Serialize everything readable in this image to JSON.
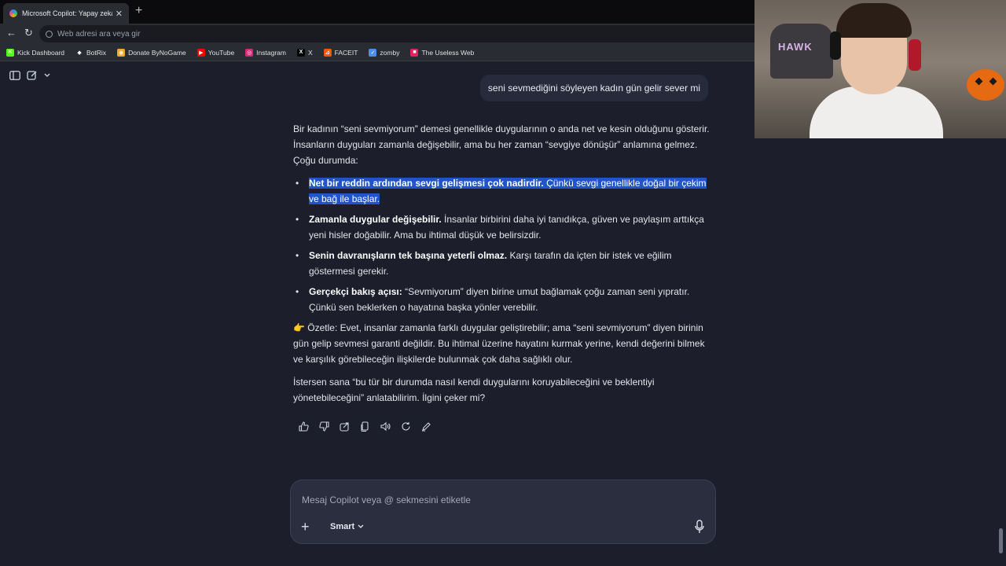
{
  "browser": {
    "tab_title": "Microsoft Copilot: Yapay zeka eşlik",
    "tab_close": "✕",
    "new_tab": "+",
    "address_placeholder": "Web adresi ara veya gir",
    "bookmarks": [
      {
        "label": "Kick Dashboard",
        "icon": "kick-icon",
        "color": "#53fc18",
        "glyph": "K"
      },
      {
        "label": "BotRix",
        "icon": "botrix-icon",
        "color": "#ffffff",
        "glyph": "◆"
      },
      {
        "label": "Donate ByNoGame",
        "icon": "bynogame-icon",
        "color": "#f5a623",
        "glyph": "◉"
      },
      {
        "label": "YouTube",
        "icon": "youtube-icon",
        "color": "#ff0000",
        "glyph": "▶"
      },
      {
        "label": "Instagram",
        "icon": "instagram-icon",
        "color": "#d62976",
        "glyph": "◎"
      },
      {
        "label": "X",
        "icon": "x-icon",
        "color": "#000000",
        "glyph": "X"
      },
      {
        "label": "FACEIT",
        "icon": "faceit-icon",
        "color": "#ff5500",
        "glyph": "⊿"
      },
      {
        "label": "zomby",
        "icon": "zomby-icon",
        "color": "#4a8ef0",
        "glyph": "✓"
      },
      {
        "label": "The Useless Web",
        "icon": "uselessweb-icon",
        "color": "#e0245e",
        "glyph": "■"
      }
    ]
  },
  "chat": {
    "user_message": "seni sevmediğini söyleyen kadın gün gelir sever mi",
    "intro": "Bir kadının “seni sevmiyorum” demesi genellikle duygularının o anda net ve kesin olduğunu gösterir. İnsanların duyguları zamanla değişebilir, ama bu her zaman “sevgiye dönüşür” anlamına gelmez. Çoğu durumda:",
    "bullets": [
      {
        "bold": "Net bir reddin ardından sevgi gelişmesi çok nadirdir.",
        "text": " Çünkü sevgi genellikle doğal bir çekim ve bağ ile başlar."
      },
      {
        "bold": "Zamanla duygular değişebilir.",
        "text": " İnsanlar birbirini daha iyi tanıdıkça, güven ve paylaşım arttıkça yeni hisler doğabilir. Ama bu ihtimal düşük ve belirsizdir."
      },
      {
        "bold": "Senin davranışların tek başına yeterli olmaz.",
        "text": " Karşı tarafın da içten bir istek ve eğilim göstermesi gerekir."
      },
      {
        "bold": "Gerçekçi bakış açısı:",
        "text": " “Sevmiyorum” diyen birine umut bağlamak çoğu zaman seni yıpratır. Çünkü sen beklerken o hayatına başka yönler verebilir."
      }
    ],
    "summary": "👉 Özetle: Evet, insanlar zamanla farklı duygular geliştirebilir; ama “seni sevmiyorum” diyen birinin gün gelip sevmesi garanti değildir. Bu ihtimal üzerine hayatını kurmak yerine, kendi değerini bilmek ve karşılık görebileceğin ilişkilerde bulunmak çok daha sağlıklı olur.",
    "offer": "İstersen sana “bu tür bir durumda nasıl kendi duygularını koruyabileceğini ve beklentiyi yönetebileceğini” anlatabilirim. İlgini çeker mi?",
    "highlight_color": "#1f55c9"
  },
  "composer": {
    "placeholder": "Mesaj Copilot veya @ sekmesini etiketle",
    "plus": "+",
    "mode": "Smart"
  },
  "webcam": {
    "chair_text": "HAWK"
  }
}
